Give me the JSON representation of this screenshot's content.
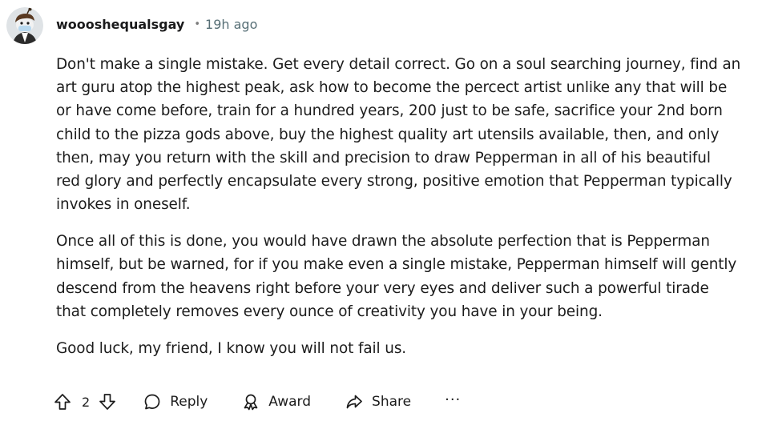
{
  "comment": {
    "author": "woooshequalsgay",
    "separator": "•",
    "timestamp": "19h ago",
    "paragraphs": [
      "Don't make a single mistake. Get every detail correct. Go on a soul searching journey, find an\nart guru atop the highest peak, ask how to become the percect artist unlike any that will be\nor have come before, train for a hundred years, 200 just to be safe, sacrifice your 2nd born\nchild to the pizza gods above, buy the highest quality art utensils available, then, and only\nthen, may you return with the skill and precision to draw Pepperman in all of his beautiful\nred glory and perfectly encapsulate every strong, positive emotion that Pepperman typically\ninvokes in oneself.",
      "Once all of this is done, you would have drawn the absolute perfection that is Pepperman\nhimself, but be warned, for if you make even a single mistake, Pepperman himself will gently\ndescend from the heavens right before your very eyes and deliver such a powerful tirade\nthat completely removes every ounce of creativity you have in your being.",
      "Good luck, my friend, I know you will not fail us."
    ]
  },
  "actions": {
    "vote_count": "2",
    "reply_label": "Reply",
    "award_label": "Award",
    "share_label": "Share",
    "more_label": "···"
  },
  "icons": {
    "upvote": "upvote-arrow-icon",
    "downvote": "downvote-arrow-icon",
    "reply": "speech-bubble-icon",
    "award": "award-ribbon-icon",
    "share": "share-arrow-icon",
    "more": "ellipsis-icon"
  }
}
